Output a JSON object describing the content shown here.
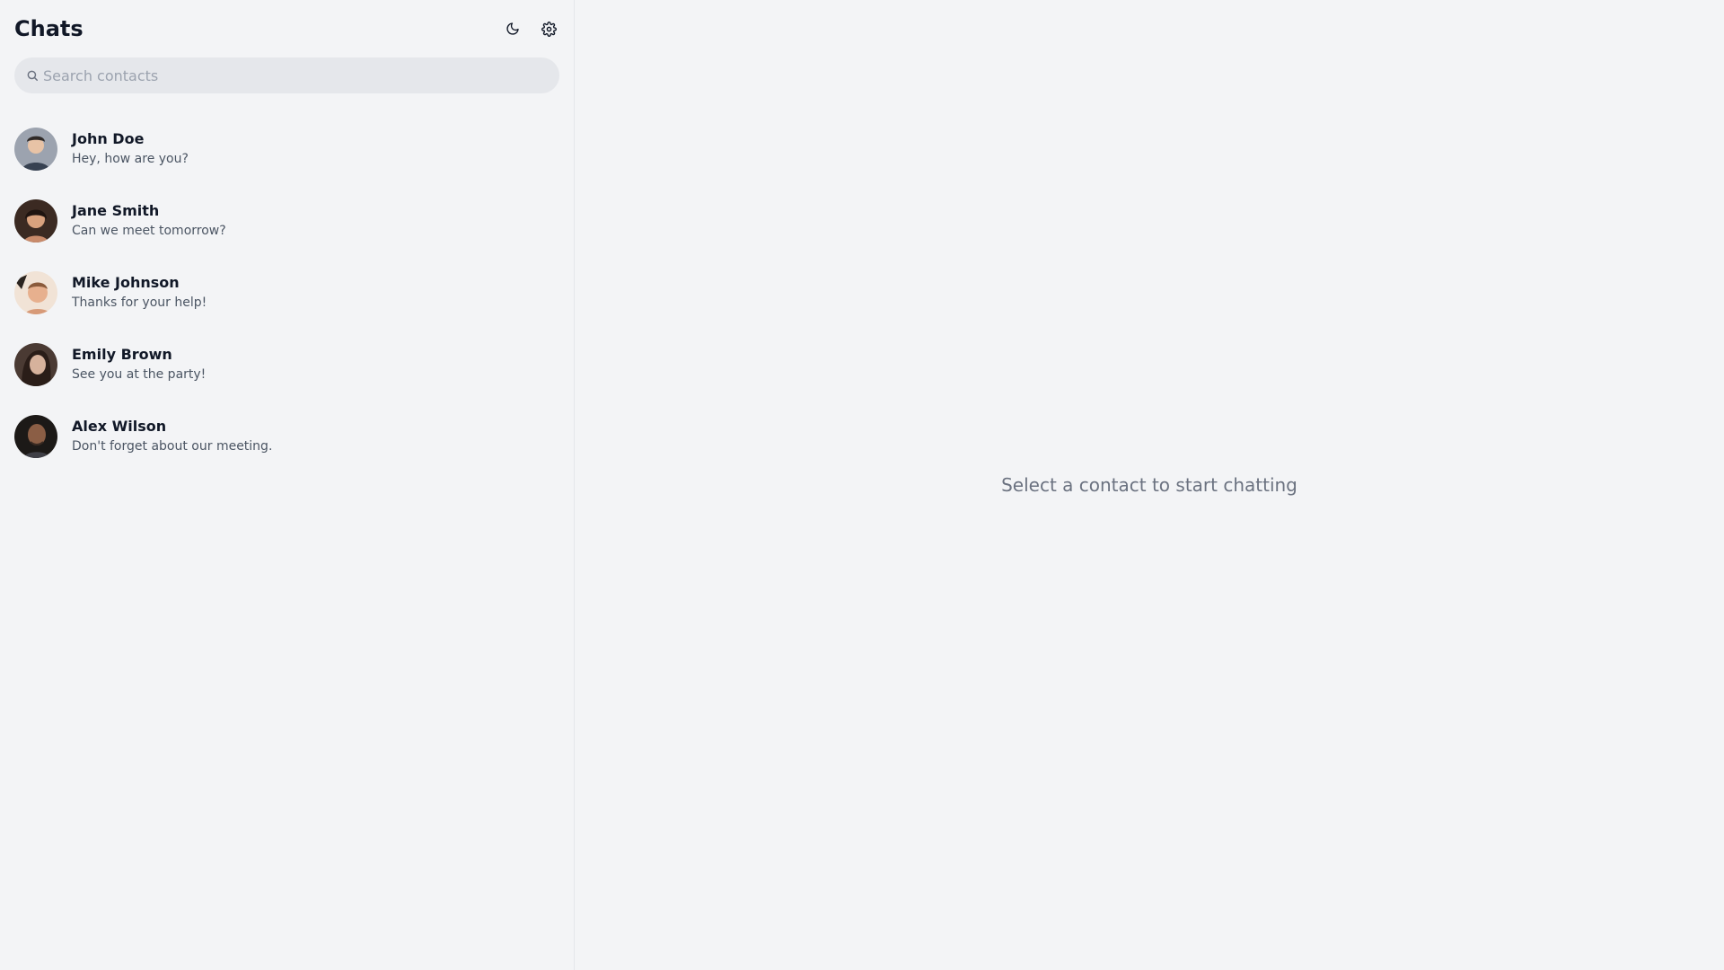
{
  "sidebar": {
    "title": "Chats",
    "header_icons": [
      "moon-icon",
      "gear-icon"
    ],
    "search": {
      "placeholder": "Search contacts",
      "value": ""
    },
    "contacts": [
      {
        "name": "John Doe",
        "last_message": "Hey, how are you?"
      },
      {
        "name": "Jane Smith",
        "last_message": "Can we meet tomorrow?"
      },
      {
        "name": "Mike Johnson",
        "last_message": "Thanks for your help!"
      },
      {
        "name": "Emily Brown",
        "last_message": "See you at the party!"
      },
      {
        "name": "Alex Wilson",
        "last_message": "Don't forget about our meeting."
      }
    ]
  },
  "main": {
    "empty_state": "Select a contact to start chatting"
  },
  "colors": {
    "background": "#f3f4f6",
    "search_bg": "#e5e7eb",
    "text_primary": "#111827",
    "text_secondary": "#4b5563",
    "text_muted": "#6b7280"
  }
}
